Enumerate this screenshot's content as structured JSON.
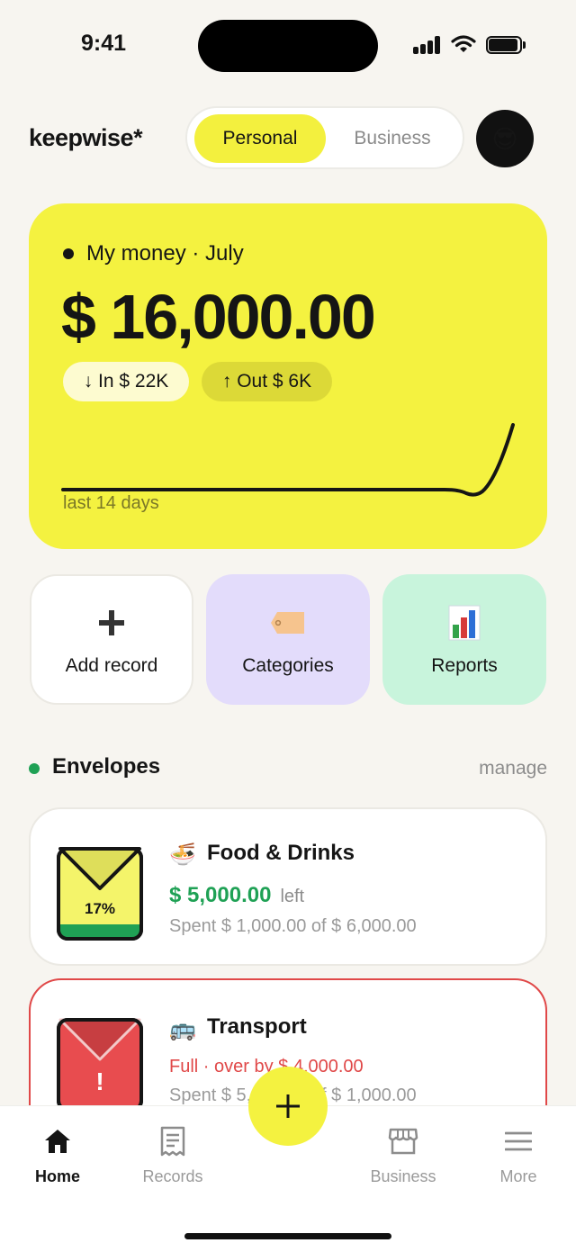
{
  "status": {
    "time": "9:41"
  },
  "header": {
    "logo": "keepwise*",
    "segments": [
      "Personal",
      "Business"
    ],
    "active_segment": "Personal",
    "avatar_emoji": "😎"
  },
  "money": {
    "label": "My money · July",
    "amount": "$ 16,000.00",
    "in_label": "↓ In $ 22K",
    "out_label": "↑ Out $ 6K",
    "spark_caption": "last 14 days",
    "accent_color": "#f4f240"
  },
  "actions": [
    {
      "label": "Add record",
      "icon": "plus-icon"
    },
    {
      "label": "Categories",
      "icon": "tag-icon"
    },
    {
      "label": "Reports",
      "icon": "bar-chart-icon"
    }
  ],
  "envelopes": {
    "title": "Envelopes",
    "manage": "manage",
    "items": [
      {
        "emoji": "🍜",
        "name": "Food & Drinks",
        "amount_left": "$ 5,000.00",
        "left_word": "left",
        "spent": "Spent $ 1,000.00 of $ 6,000.00",
        "percent_label": "17%",
        "percent": 0.17,
        "color": "#f4f46a"
      },
      {
        "emoji": "🚌",
        "name": "Transport",
        "warning": "Full · over by $ 4,000.00",
        "spent": "Spent $ 5,000.00 of $ 1,000.00",
        "badge": "!",
        "color": "#e84c4f"
      }
    ]
  },
  "tabbar": {
    "tabs": [
      {
        "label": "Home",
        "icon": "home-icon",
        "active": true
      },
      {
        "label": "Records",
        "icon": "receipt-icon",
        "active": false
      },
      {
        "label": "Business",
        "icon": "store-icon",
        "active": false
      },
      {
        "label": "More",
        "icon": "menu-icon",
        "active": false
      }
    ],
    "fab_icon": "plus-icon"
  }
}
